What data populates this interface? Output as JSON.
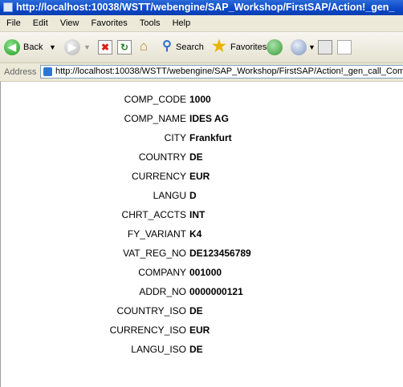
{
  "window": {
    "title": "http://localhost:10038/WSTT/webengine/SAP_Workshop/FirstSAP/Action!_gen_"
  },
  "menu": [
    "File",
    "Edit",
    "View",
    "Favorites",
    "Tools",
    "Help"
  ],
  "toolbar": {
    "back_label": "Back",
    "search_label": "Search",
    "favorites_label": "Favorites"
  },
  "address": {
    "label": "Address",
    "url": "http://localhost:10038/WSTT/webengine/SAP_Workshop/FirstSAP/Action!_gen_call_Compar"
  },
  "fields": [
    {
      "key": "COMP_CODE",
      "value": "1000"
    },
    {
      "key": "COMP_NAME",
      "value": "IDES AG"
    },
    {
      "key": "CITY",
      "value": "Frankfurt"
    },
    {
      "key": "COUNTRY",
      "value": "DE"
    },
    {
      "key": "CURRENCY",
      "value": "EUR"
    },
    {
      "key": "LANGU",
      "value": "D"
    },
    {
      "key": "CHRT_ACCTS",
      "value": "INT"
    },
    {
      "key": "FY_VARIANT",
      "value": "K4"
    },
    {
      "key": "VAT_REG_NO",
      "value": "DE123456789"
    },
    {
      "key": "COMPANY",
      "value": "001000"
    },
    {
      "key": "ADDR_NO",
      "value": "0000000121"
    },
    {
      "key": "COUNTRY_ISO",
      "value": "DE"
    },
    {
      "key": "CURRENCY_ISO",
      "value": "EUR"
    },
    {
      "key": "LANGU_ISO",
      "value": "DE"
    }
  ]
}
